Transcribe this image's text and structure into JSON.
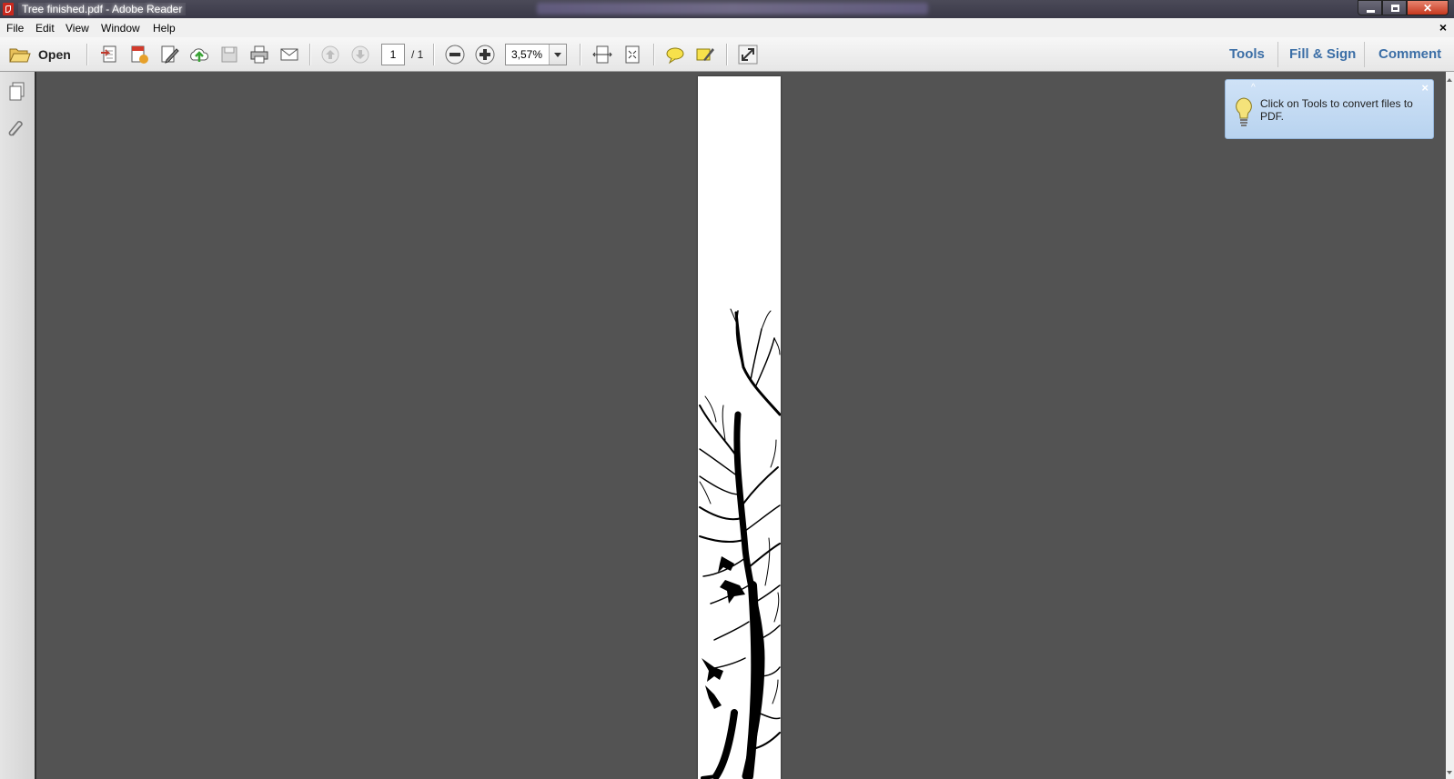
{
  "window": {
    "title": "Tree finished.pdf - Adobe Reader",
    "close_glyph": "✕"
  },
  "menu": {
    "items": [
      "File",
      "Edit",
      "View",
      "Window",
      "Help"
    ],
    "close_doc_glyph": "×"
  },
  "toolbar": {
    "open_label": "Open",
    "page_current": "1",
    "page_total": "/ 1",
    "zoom": "3,57%",
    "tabs": [
      "Tools",
      "Fill & Sign",
      "Comment"
    ]
  },
  "tooltip": {
    "text": "Click on Tools to convert files to PDF.",
    "close_glyph": "×",
    "caret_glyph": "^"
  },
  "colors": {
    "doc_background": "#535353",
    "tab_text": "#3b6ea6",
    "tooltip_bg": "#c4dbf3"
  }
}
